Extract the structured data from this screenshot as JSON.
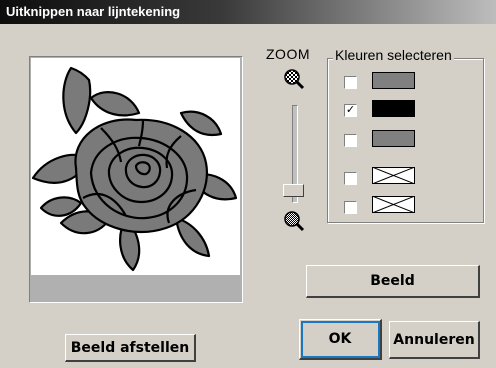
{
  "window": {
    "title": "Uitknippen naar lijntekening"
  },
  "zoom": {
    "label": "ZOOM",
    "zoom_in_icon": "magnifier-plus-icon",
    "zoom_out_icon": "magnifier-minus-icon"
  },
  "colors_group": {
    "label": "Kleuren selecteren",
    "items": [
      {
        "checked": false,
        "color": "#808080",
        "mark": ""
      },
      {
        "checked": true,
        "color": "#000000",
        "mark": "✓"
      },
      {
        "checked": false,
        "color": "#808080",
        "mark": ""
      },
      {
        "checked": false,
        "color": "none",
        "mark": ""
      },
      {
        "checked": false,
        "color": "none",
        "mark": ""
      }
    ]
  },
  "buttons": {
    "view": "Beeld",
    "ok": "OK",
    "cancel": "Annuleren",
    "adjust_view": "Beeld afstellen"
  },
  "preview": {
    "image": "rose-line-drawing"
  }
}
